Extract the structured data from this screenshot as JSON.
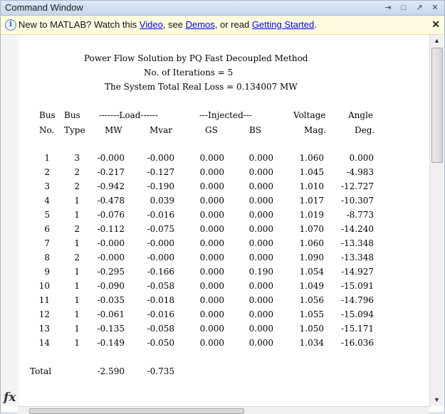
{
  "window": {
    "title": "Command Window",
    "controls": [
      "⇥",
      "□",
      "↗",
      "✕"
    ]
  },
  "infobar": {
    "text_prefix": "New to MATLAB? Watch this ",
    "link_video": "Video",
    "text_mid1": ", see ",
    "link_demos": "Demos",
    "text_mid2": ", or read ",
    "link_getting_started": "Getting Started",
    "text_suffix": ".",
    "close": "✕"
  },
  "output": {
    "title1": "Power Flow Solution by PQ Fast Decoupled Method",
    "title2": "No. of Iterations = 5",
    "title3": "The System Total Real Loss = 0.134007 MW",
    "header1": {
      "bus": "Bus",
      "bus2": "Bus",
      "load": "-------Load------",
      "injected": "---Injected---",
      "voltage": "Voltage",
      "angle": "Angle"
    },
    "header2": {
      "no": "No.",
      "type": "Type",
      "mw": "MW",
      "mvar": "Mvar",
      "gs": "GS",
      "bs": "BS",
      "mag": "Mag.",
      "deg": "Deg."
    },
    "rows": [
      [
        "1",
        "3",
        "-0.000",
        "-0.000",
        "0.000",
        "0.000",
        "1.060",
        "0.000"
      ],
      [
        "2",
        "2",
        "-0.217",
        "-0.127",
        "0.000",
        "0.000",
        "1.045",
        "-4.983"
      ],
      [
        "3",
        "2",
        "-0.942",
        "-0.190",
        "0.000",
        "0.000",
        "1.010",
        "-12.727"
      ],
      [
        "4",
        "1",
        "-0.478",
        "0.039",
        "0.000",
        "0.000",
        "1.017",
        "-10.307"
      ],
      [
        "5",
        "1",
        "-0.076",
        "-0.016",
        "0.000",
        "0.000",
        "1.019",
        "-8.773"
      ],
      [
        "6",
        "2",
        "-0.112",
        "-0.075",
        "0.000",
        "0.000",
        "1.070",
        "-14.240"
      ],
      [
        "7",
        "1",
        "-0.000",
        "-0.000",
        "0.000",
        "0.000",
        "1.060",
        "-13.348"
      ],
      [
        "8",
        "2",
        "-0.000",
        "-0.000",
        "0.000",
        "0.000",
        "1.090",
        "-13.348"
      ],
      [
        "9",
        "1",
        "-0.295",
        "-0.166",
        "0.000",
        "0.190",
        "1.054",
        "-14.927"
      ],
      [
        "10",
        "1",
        "-0.090",
        "-0.058",
        "0.000",
        "0.000",
        "1.049",
        "-15.091"
      ],
      [
        "11",
        "1",
        "-0.035",
        "-0.018",
        "0.000",
        "0.000",
        "1.056",
        "-14.796"
      ],
      [
        "12",
        "1",
        "-0.061",
        "-0.016",
        "0.000",
        "0.000",
        "1.055",
        "-15.094"
      ],
      [
        "13",
        "1",
        "-0.135",
        "-0.058",
        "0.000",
        "0.000",
        "1.050",
        "-15.171"
      ],
      [
        "14",
        "1",
        "-0.149",
        "-0.050",
        "0.000",
        "0.000",
        "1.034",
        "-16.036"
      ]
    ],
    "total_label": "Total",
    "total_mw": "-2.590",
    "total_mvar": "-0.735"
  },
  "prompt_icon": "fx"
}
